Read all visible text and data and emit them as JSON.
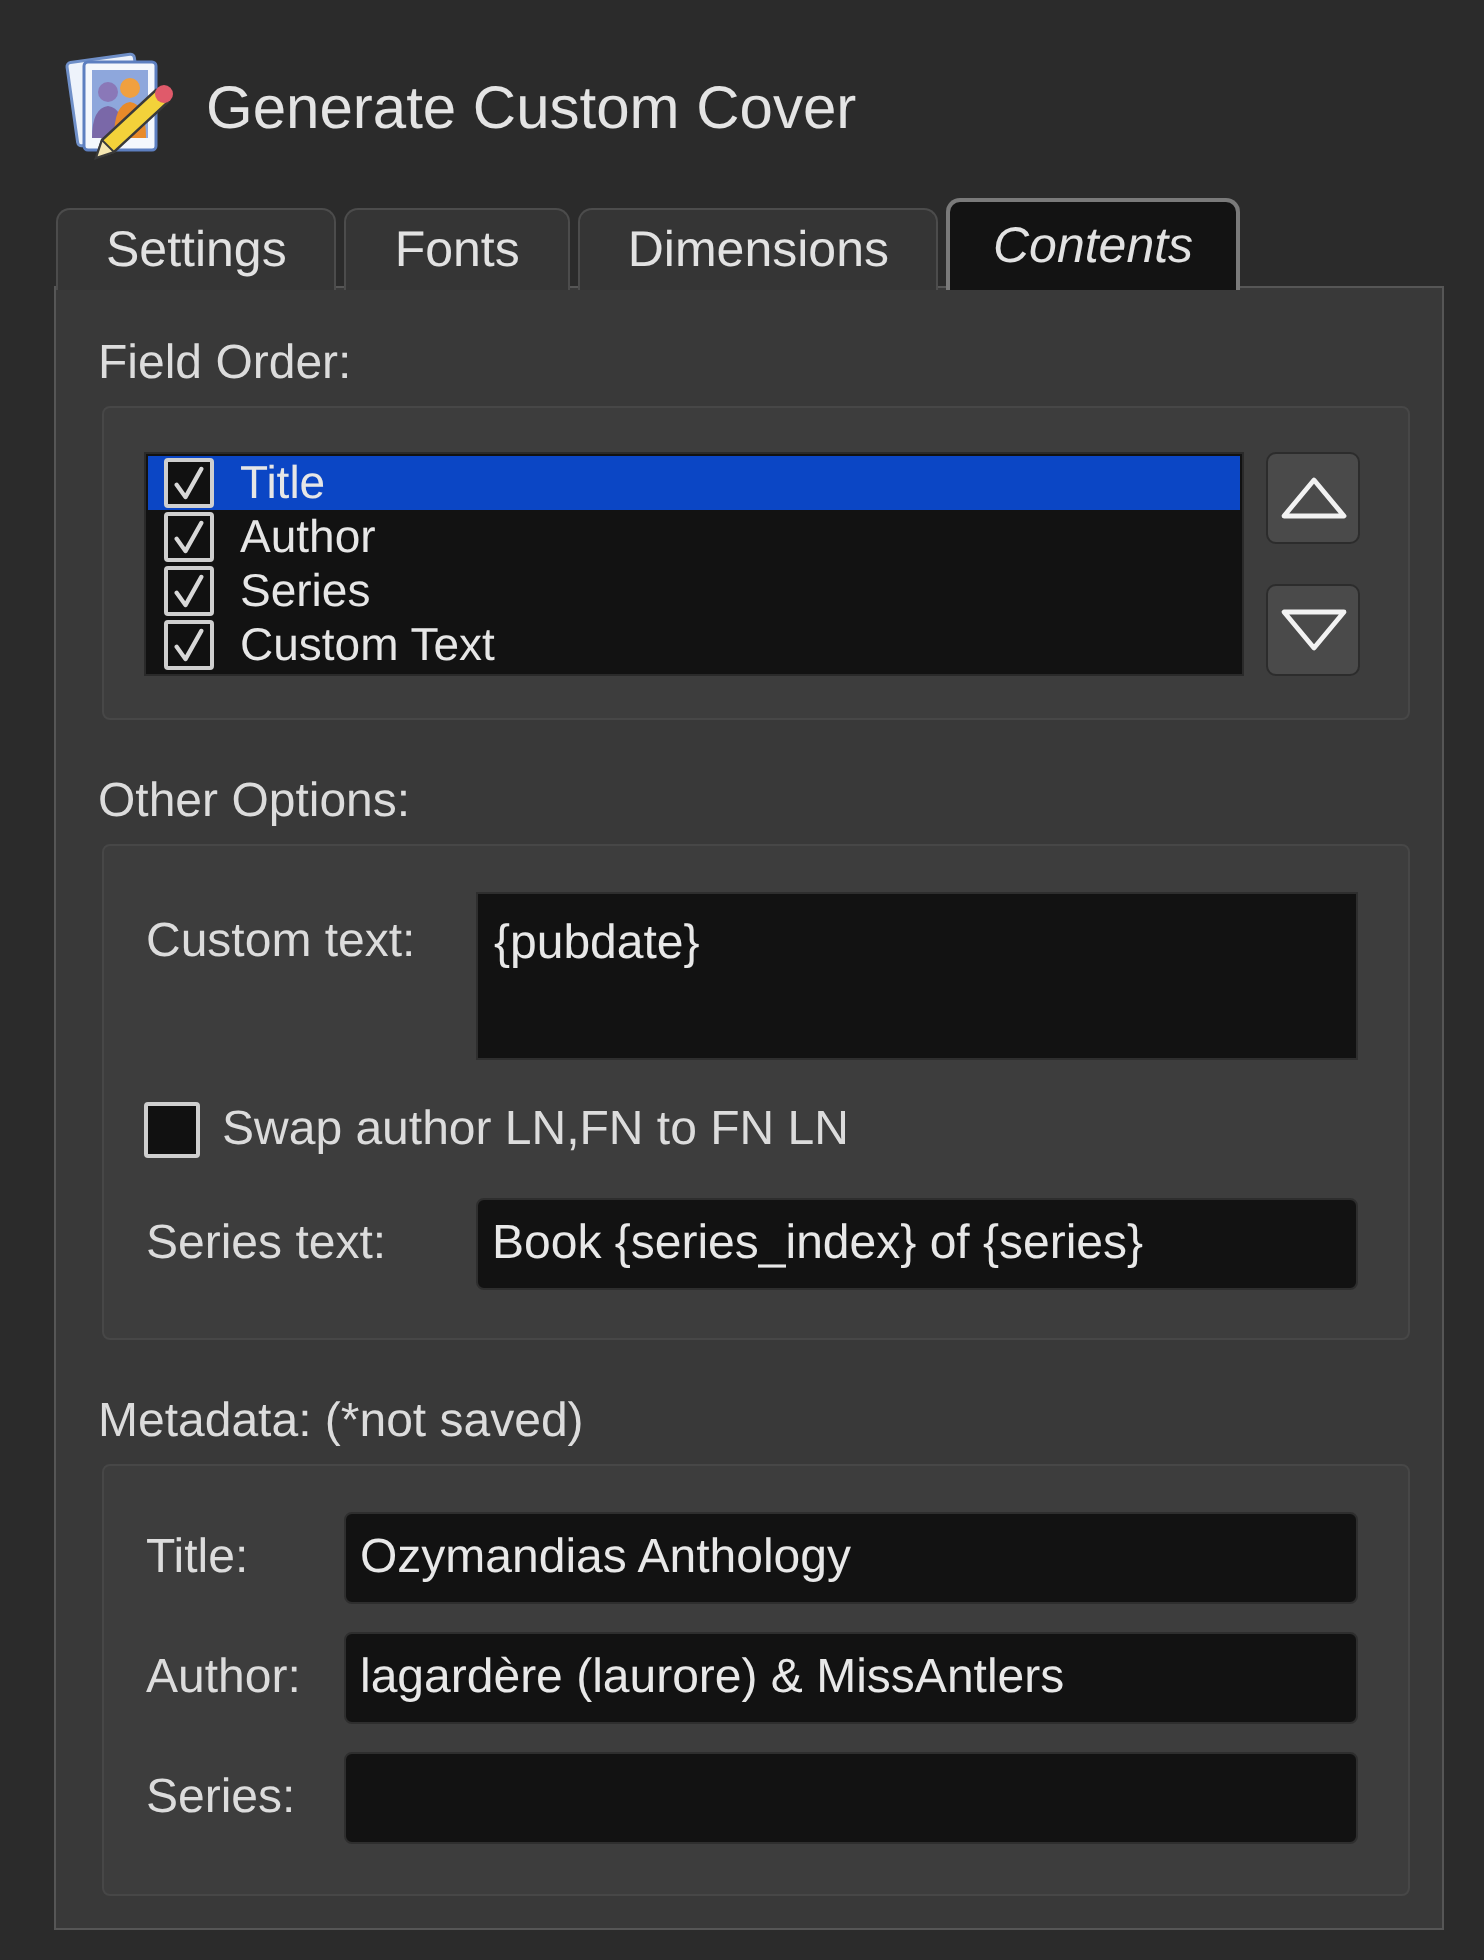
{
  "window": {
    "title": "Generate Custom Cover"
  },
  "tabs": [
    {
      "label": "Settings",
      "selected": false
    },
    {
      "label": "Fonts",
      "selected": false
    },
    {
      "label": "Dimensions",
      "selected": false
    },
    {
      "label": "Contents",
      "selected": true
    }
  ],
  "field_order": {
    "label": "Field Order:",
    "items": [
      {
        "label": "Title",
        "checked": true,
        "selected": true
      },
      {
        "label": "Author",
        "checked": true,
        "selected": false
      },
      {
        "label": "Series",
        "checked": true,
        "selected": false
      },
      {
        "label": "Custom Text",
        "checked": true,
        "selected": false
      }
    ]
  },
  "other_options": {
    "label": "Other Options:",
    "custom_text": {
      "label": "Custom text:",
      "value": "{pubdate}"
    },
    "swap_author": {
      "label": "Swap author LN,FN to FN LN",
      "checked": false
    },
    "series_text": {
      "label": "Series text:",
      "value": "Book {series_index} of {series}"
    }
  },
  "metadata": {
    "label": "Metadata: (*not saved)",
    "fields": [
      {
        "label": "Title:",
        "value": "Ozymandias Anthology"
      },
      {
        "label": "Author:",
        "value": "lagardère (laurore) & MissAntlers"
      },
      {
        "label": "Series:"
      }
    ]
  }
}
